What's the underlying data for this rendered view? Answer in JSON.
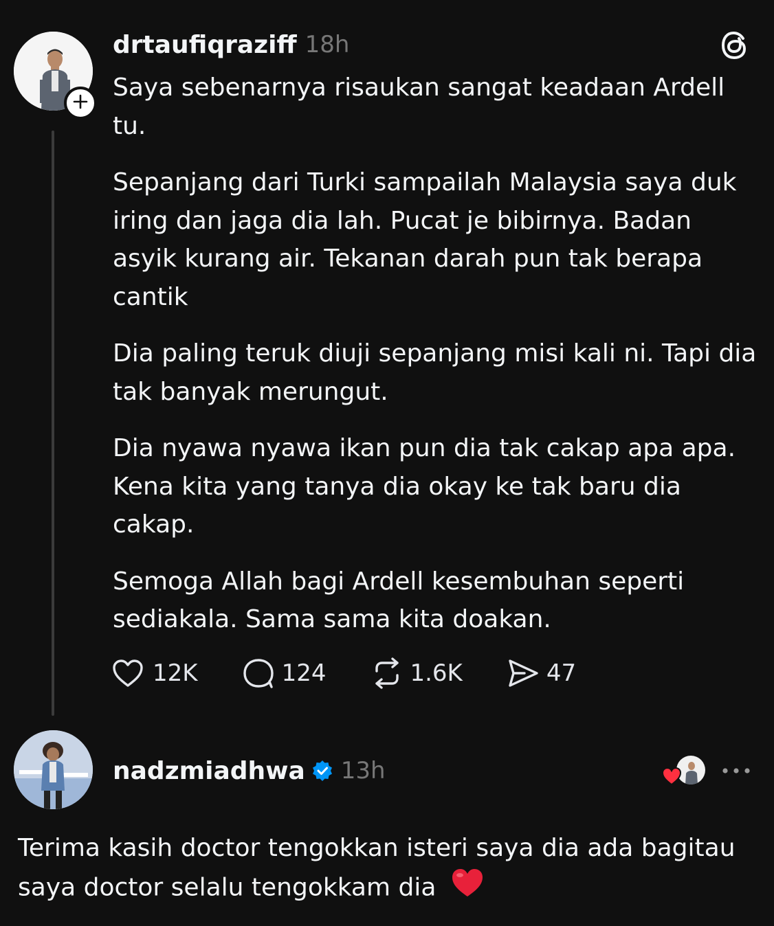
{
  "post": {
    "username": "drtaufiqraziff",
    "time": "18h",
    "paragraphs": [
      "Saya sebenarnya risaukan sangat keadaan Ardell tu.",
      "Sepanjang dari Turki sampailah Malaysia saya duk iring dan jaga dia lah. Pucat je bibirnya. Badan asyik kurang air. Tekanan darah pun tak berapa cantik",
      "Dia paling teruk diuji sepanjang misi kali ni. Tapi dia tak banyak merungut.",
      "Dia nyawa nyawa ikan pun dia tak cakap apa apa. Kena kita yang tanya dia okay ke tak baru dia cakap.",
      "Semoga Allah bagi Ardell kesembuhan seperti sediakala. Sama sama kita doakan."
    ],
    "actions": {
      "likes": "12K",
      "comments": "124",
      "reposts": "1.6K",
      "shares": "47"
    }
  },
  "reply": {
    "username": "nadzmiadhwa",
    "verified": true,
    "time": "13h",
    "text": "Terima kasih doctor tengokkan isteri saya dia ada bagitau saya doctor selalu tengokkam dia",
    "emoji": "❤️"
  },
  "icons": {
    "app_logo": "threads-logo-icon",
    "follow": "plus-icon",
    "like": "heart-outline-icon",
    "comment": "comment-bubble-icon",
    "repost": "repost-icon",
    "share": "send-icon",
    "verified": "verified-badge-icon",
    "liked_by_author": "red-heart-icon",
    "more": "more-dots-icon"
  },
  "colors": {
    "background": "#101010",
    "text": "#f3f5f7",
    "secondary_text": "#777777",
    "verified_blue": "#0095f6",
    "heart_red": "#ff3040"
  }
}
